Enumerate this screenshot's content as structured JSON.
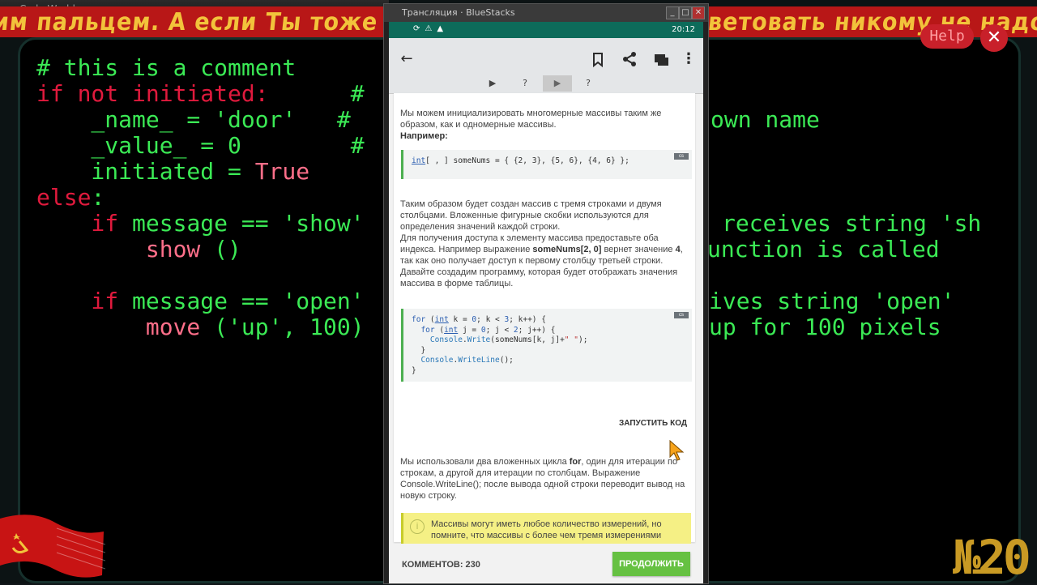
{
  "game": {
    "window_title": "Code World",
    "marquee": "им пальцем. А если Ты тоже прогер - подпишись! Советовать никому не надо, так как все",
    "help_label": "Help",
    "close_label": "✕",
    "level_label": "№20",
    "code_lines": [
      {
        "parts": [
          {
            "t": "# this is a comment",
            "c": "plain"
          }
        ]
      },
      {
        "parts": [
          {
            "t": "if not initiated:",
            "c": "kw"
          },
          {
            "t": "      #",
            "c": "plain"
          }
        ]
      },
      {
        "parts": [
          {
            "t": "    _name_ = ",
            "c": "plain"
          },
          {
            "t": "'door'",
            "c": "plain"
          },
          {
            "t": "   #",
            "c": "plain"
          }
        ]
      },
      {
        "parts": [
          {
            "t": "    _value_ = 0",
            "c": "plain"
          },
          {
            "t": "        #",
            "c": "plain"
          }
        ]
      },
      {
        "parts": [
          {
            "t": "    initiated = ",
            "c": "plain"
          },
          {
            "t": "True",
            "c": "str"
          }
        ]
      },
      {
        "parts": [
          {
            "t": "else",
            "c": "kw"
          },
          {
            "t": ":",
            "c": "plain"
          }
        ]
      },
      {
        "parts": [
          {
            "t": "    if",
            "c": "kw"
          },
          {
            "t": " message == 'show'",
            "c": "plain"
          }
        ]
      },
      {
        "parts": [
          {
            "t": "        show",
            "c": "str"
          },
          {
            "t": " ()",
            "c": "plain"
          }
        ]
      },
      {
        "parts": [
          {
            "t": " ",
            "c": "plain"
          }
        ]
      },
      {
        "parts": [
          {
            "t": "    if",
            "c": "kw"
          },
          {
            "t": " message == 'open'",
            "c": "plain"
          }
        ]
      },
      {
        "parts": [
          {
            "t": "        move",
            "c": "str"
          },
          {
            "t": " ('up', 100)",
            "c": "plain"
          }
        ]
      }
    ],
    "right_fragments": [
      "own name",
      "receives string 'sh",
      "unction is called",
      "ives string 'open'",
      "up for 100 pixels"
    ]
  },
  "bluestacks": {
    "title": "Трансляция · BlueStacks",
    "time": "20:12",
    "lesson_tabs": [
      "▶",
      "?",
      "▶",
      "?"
    ],
    "para1": "Мы можем инициализировать многомерные массивы таким же образом, как и одномерные массивы.",
    "para1_bold": "Например:",
    "code1_kw": "int",
    "code1_rest": "[ , ] someNums = { {2, 3}, {5, 6}, {4, 6} };",
    "cs_tag": "cs",
    "para2a": "Таким образом будет создан массив с тремя строками и двумя столбцами. Вложенные фигурные скобки используются для определения значений каждой строки.",
    "para2b_1": "Для получения доступа к элементу массива предоставьте оба индекса. Например выражение ",
    "para2b_bold": "someNums[2, 0]",
    "para2b_2": " вернет значение ",
    "para2b_bold2": "4",
    "para2b_3": ", так как оно получает доступ к первому столбцу третьей строки.",
    "para2c": "Давайте создадим программу, которая будет отображать значения массива в форме таблицы.",
    "run_label": "ЗАПУСТИТЬ КОД",
    "para3_1": "Мы использовали два вложенных цикла ",
    "para3_bold": "for",
    "para3_2": ", один для итерации по строкам, а другой для итерации по столбцам. Выражение Console.WriteLine(); после вывода одной строки переводит вывод на новую строку.",
    "note": "Массивы могут иметь любое количество измерений, но помните, что массивы с более чем тремя измерениями являются сложными в управлении.",
    "comments_label": "КОММЕНТОВ: 230",
    "next_label": "ПРОДОЛЖИТЬ"
  },
  "colors": {
    "code_green": "#3bea55",
    "keyword_red": "#e01a3d",
    "marquee_bg": "#b81717",
    "marquee_text": "#f2c33b",
    "accent_green": "#66c142",
    "note_yellow": "#f5f085"
  }
}
